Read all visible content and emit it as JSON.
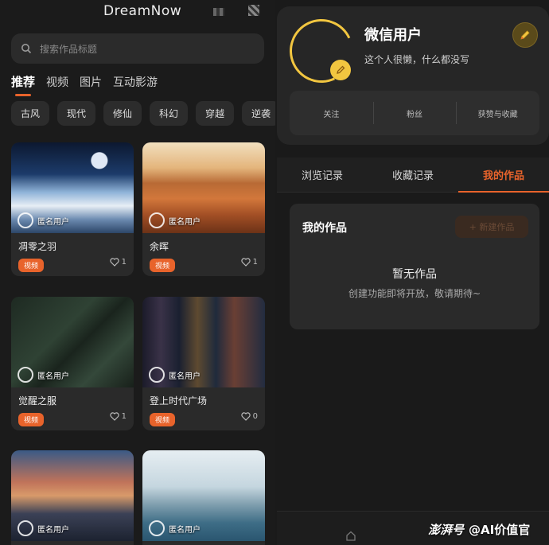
{
  "left": {
    "brand": "DreamNow",
    "search": {
      "placeholder": "搜索作品标题"
    },
    "tabs": [
      "推荐",
      "视频",
      "图片",
      "互动影游"
    ],
    "chips": [
      "古风",
      "现代",
      "修仙",
      "科幻",
      "穿越",
      "逆袭"
    ],
    "cards": [
      {
        "title": "凋零之羽",
        "author": "匿名用户",
        "badge": "视频",
        "likes": "1"
      },
      {
        "title": "余晖",
        "author": "匿名用户",
        "badge": "视频",
        "likes": "1"
      },
      {
        "title": "觉醒之服",
        "author": "匿名用户",
        "badge": "视频",
        "likes": "1"
      },
      {
        "title": "登上时代广场",
        "author": "匿名用户",
        "badge": "视频",
        "likes": "0"
      },
      {
        "title": "",
        "author": "匿名用户",
        "badge": "",
        "likes": ""
      },
      {
        "title": "",
        "author": "匿名用户",
        "badge": "",
        "likes": ""
      }
    ]
  },
  "right": {
    "profile": {
      "name": "微信用户",
      "bio": "这个人很懒，什么都没写"
    },
    "stats": [
      "关注",
      "粉丝",
      "获赞与收藏"
    ],
    "tabs": [
      "浏览记录",
      "收藏记录",
      "我的作品"
    ],
    "works": {
      "title": "我的作品",
      "new_button": "+ 新建作品",
      "empty_title": "暂无作品",
      "empty_hint": "创建功能即将开放，敬请期待~"
    },
    "watermark_brand": "澎湃号",
    "watermark_text": "@AI价值官"
  },
  "colors": {
    "accent": "#e8632b",
    "gold": "#f2c640",
    "bg": "#1b1b1b"
  }
}
